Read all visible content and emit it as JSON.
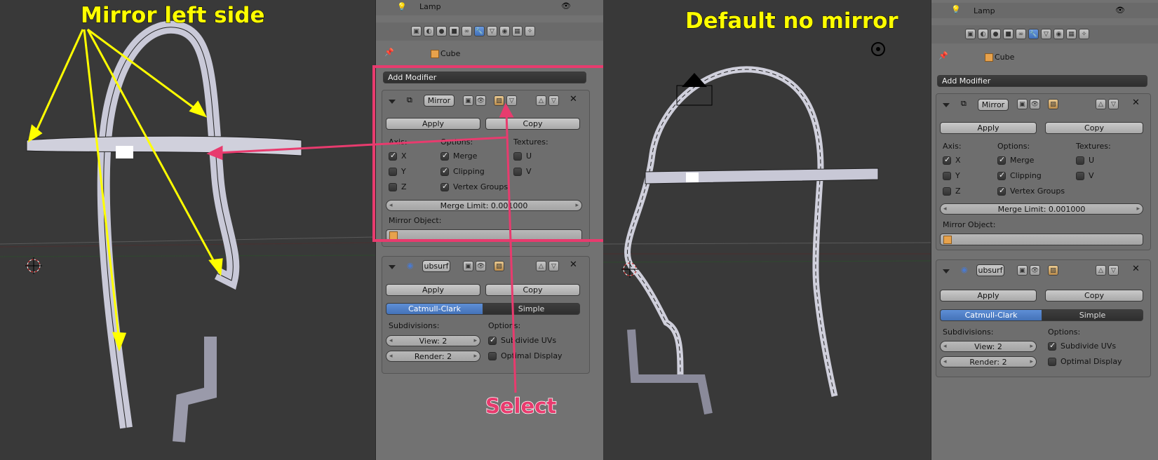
{
  "annotations": {
    "mirror_left_side": "Mirror left side",
    "default_no_mirror": "Default no mirror",
    "select": "Select"
  },
  "colors": {
    "yellow": "#ffff00",
    "pink": "#e83b6e",
    "panel": "#727272",
    "viewport": "#393939",
    "blue": "#5a8ad4"
  },
  "left_panel": {
    "outliner_item": "Lamp",
    "breadcrumb_object": "Cube",
    "add_modifier": "Add Modifier",
    "mirror": {
      "name": "Mirror",
      "apply": "Apply",
      "copy": "Copy",
      "axis_label": "Axis:",
      "options_label": "Options:",
      "textures_label": "Textures:",
      "x": "X",
      "y": "Y",
      "z": "Z",
      "merge": "Merge",
      "clipping": "Clipping",
      "vertex_groups": "Vertex Groups",
      "u": "U",
      "v": "V",
      "merge_limit": "Merge Limit: 0.001000",
      "mirror_object": "Mirror Object:"
    },
    "subsurf": {
      "name": "ubsurf",
      "apply": "Apply",
      "copy": "Copy",
      "catmull": "Catmull-Clark",
      "simple": "Simple",
      "subdivisions_label": "Subdivisions:",
      "options_label": "Options:",
      "view": "View: 2",
      "render": "Render: 2",
      "subdivide_uvs": "Subdivide UVs",
      "optimal_display": "Optimal Display"
    }
  },
  "right_panel": {
    "outliner_item": "Lamp",
    "breadcrumb_object": "Cube",
    "add_modifier": "Add Modifier",
    "mirror": {
      "name": "Mirror",
      "apply": "Apply",
      "copy": "Copy",
      "axis_label": "Axis:",
      "options_label": "Options:",
      "textures_label": "Textures:",
      "x": "X",
      "y": "Y",
      "z": "Z",
      "merge": "Merge",
      "clipping": "Clipping",
      "vertex_groups": "Vertex Groups",
      "u": "U",
      "v": "V",
      "merge_limit": "Merge Limit: 0.001000",
      "mirror_object": "Mirror Object:"
    },
    "subsurf": {
      "name": "ubsurf",
      "apply": "Apply",
      "copy": "Copy",
      "catmull": "Catmull-Clark",
      "simple": "Simple",
      "subdivisions_label": "Subdivisions:",
      "options_label": "Options:",
      "view": "View: 2",
      "render": "Render: 2",
      "subdivide_uvs": "Subdivide UVs",
      "optimal_display": "Optimal Display"
    }
  }
}
